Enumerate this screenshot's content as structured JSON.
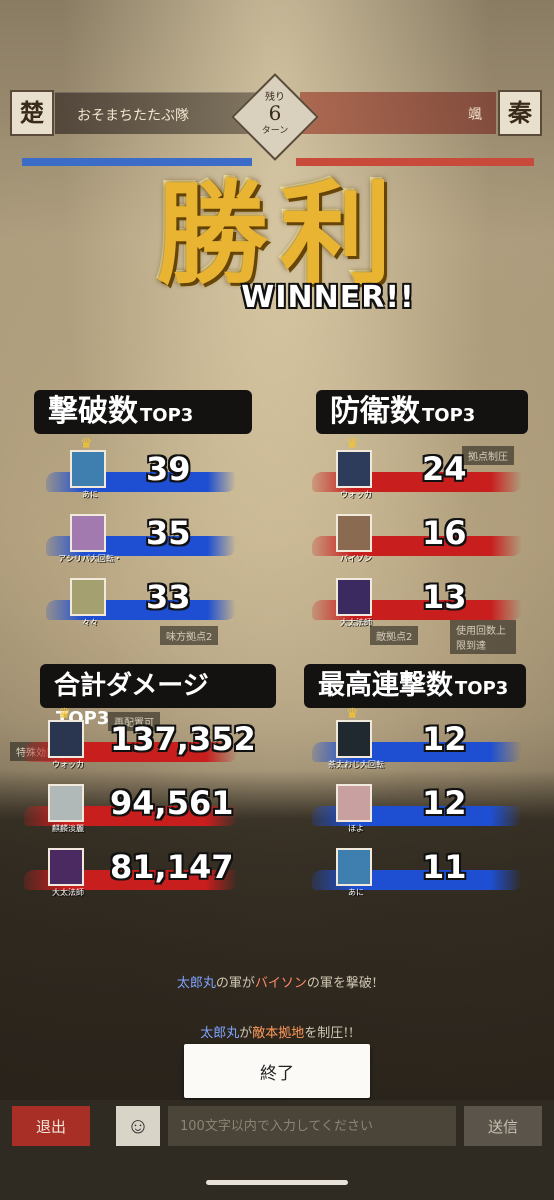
{
  "header": {
    "left_flag": "楚",
    "left_team": "おそまちたたぶ隊",
    "turn_label_top": "残り",
    "turn_number": "6",
    "turn_label_bottom": "ターン",
    "right_team": "颯",
    "right_flag": "秦"
  },
  "victory": {
    "title": "勝利",
    "subtitle": "WINNER!!"
  },
  "sections": {
    "defeats": {
      "title": "撃破数",
      "suffix": "TOP3",
      "entries": [
        {
          "name": "あに",
          "value": "39"
        },
        {
          "name": "アシリパ大回転・",
          "value": "35"
        },
        {
          "name": "々々",
          "value": "33"
        }
      ]
    },
    "defense": {
      "title": "防衛数",
      "suffix": "TOP3",
      "entries": [
        {
          "name": "ウォッカ",
          "value": "24"
        },
        {
          "name": "バイソン",
          "value": "16"
        },
        {
          "name": "大太法師",
          "value": "13"
        }
      ]
    },
    "damage": {
      "title": "合計ダメージ",
      "suffix": "TOP3",
      "entries": [
        {
          "name": "ウォッカ",
          "value": "137,352"
        },
        {
          "name": "麒麟淡麗",
          "value": "94,561"
        },
        {
          "name": "大太法師",
          "value": "81,147"
        }
      ]
    },
    "combo": {
      "title": "最高連撃数",
      "suffix": "TOP3",
      "entries": [
        {
          "name": "茶太おじ大回転",
          "value": "12"
        },
        {
          "name": "ほよ",
          "value": "12"
        },
        {
          "name": "あに",
          "value": "11"
        }
      ]
    }
  },
  "board_markers": {
    "m1": "味方拠点2",
    "m2": "敵拠点2",
    "m3": "再配置可",
    "m4": "特殊効果",
    "m5": "拠点制圧",
    "m6": "使用回数上限到達"
  },
  "log": {
    "line1_a": "太郎丸",
    "line1_b": "の軍が",
    "line1_c": "バイソン",
    "line1_d": "の軍を撃破!",
    "line2_a": "太郎丸",
    "line2_b": "が",
    "line2_c": "敵本拠地",
    "line2_d": "を制圧!!"
  },
  "finish_button": "終了",
  "bottom_bar": {
    "exit": "退出",
    "emoji": "☺",
    "input_placeholder": "100文字以内で入力してください",
    "send": "送信"
  },
  "colors": {
    "blue_stroke": "#1e4fd2",
    "red_stroke": "#c81e1e",
    "gold": "#e9b431",
    "exit_red": "#a82f26"
  }
}
